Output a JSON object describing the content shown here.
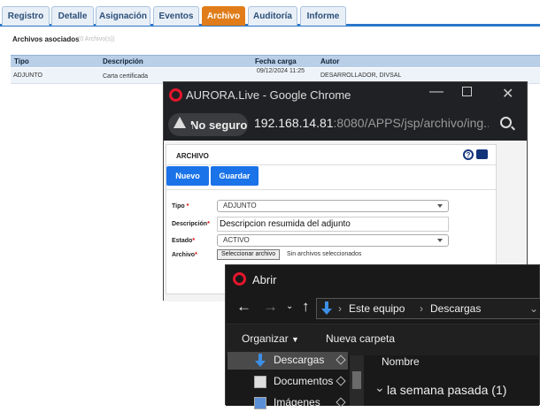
{
  "tabs": [
    "Registro",
    "Detalle",
    "Asignación",
    "Eventos",
    "Archivo",
    "Auditoría",
    "Informe"
  ],
  "active_tab": "Archivo",
  "section": {
    "title": "Archivos asociados",
    "subtitle": "(0 Archivo(s))"
  },
  "table": {
    "headers": [
      "Tipo",
      "Descripción",
      "Fecha carga",
      "Autor"
    ],
    "rows": [
      {
        "tipo": "ADJUNTO",
        "descripcion": "Carta certificada",
        "fecha": "09/12/2024 11:25",
        "autor": "DESARROLLADOR, DIVSAL"
      }
    ]
  },
  "chrome": {
    "title": "AURORA.Live - Google Chrome",
    "security": "No seguro",
    "url_host": "192.168.14.81",
    "url_path": ":8080/APPS/jsp/archivo/ing..."
  },
  "form": {
    "title": "ARCHIVO",
    "help_icon": "?",
    "buttons": {
      "nuevo": "Nuevo",
      "guardar": "Guardar"
    },
    "tipo_label": "Tipo",
    "tipo_value": "ADJUNTO",
    "descripcion_label": "Descripción",
    "descripcion_value": "Descripcion resumida del adjunto",
    "estado_label": "Estado",
    "estado_value": "ACTIVO",
    "archivo_label": "Archivo",
    "file_button": "Seleccionar archivo",
    "file_status": "Sin archivos seleccionados"
  },
  "dialog": {
    "title": "Abrir",
    "breadcrumb": [
      "Este equipo",
      "Descargas"
    ],
    "organizar": "Organizar",
    "nueva_carpeta": "Nueva carpeta",
    "sidebar": [
      "Descargas",
      "Documentos",
      "Imágenes"
    ],
    "column": "Nombre",
    "group": "la semana pasada (1)"
  },
  "colors": {
    "tab_active": "#e07d1a",
    "accent": "#2b77c9",
    "button": "#1a73e8"
  }
}
